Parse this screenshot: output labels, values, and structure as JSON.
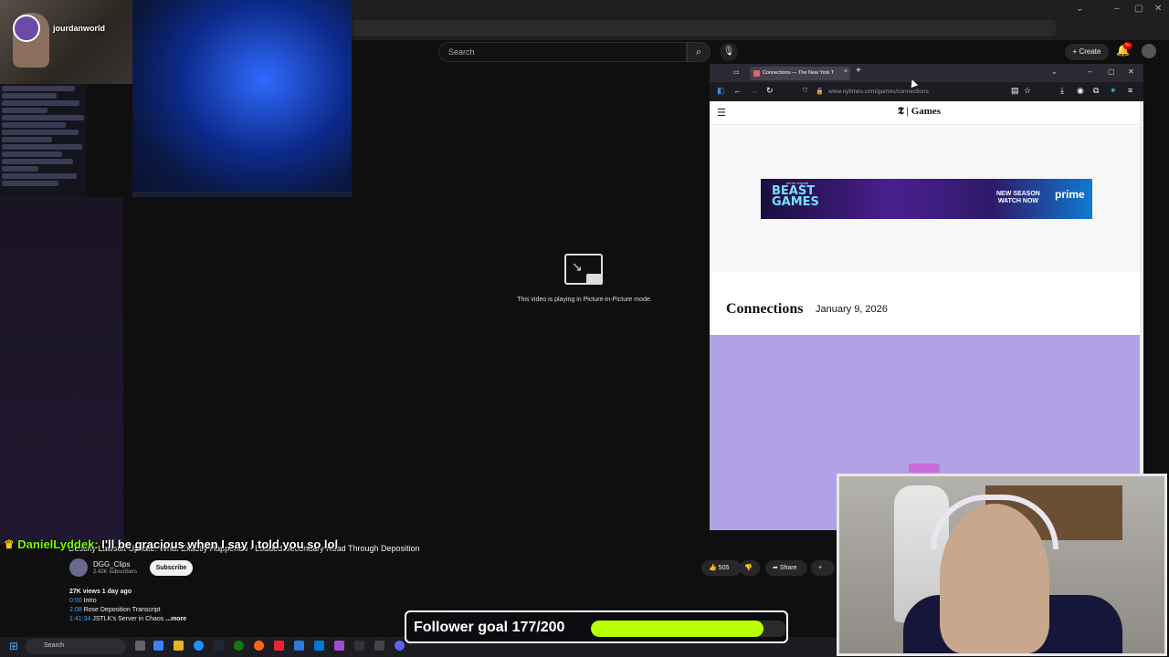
{
  "streamer": {
    "name": "jourdanworld"
  },
  "youtube": {
    "search_placeholder": "Search",
    "create_label": "Create",
    "notification_badge": "9+",
    "pip_message": "This video is playing in Picture-in-Picture mode.",
    "video_title": "Destiny Lawsuit Update: What Exactly Happened - Loaded Secondary Read Through Deposition",
    "channel_name": "DGG_Clips",
    "channel_subs": "2.42K subscribers",
    "subscribe_label": "Subscribe",
    "likes": "505",
    "share_label": "Share",
    "views_line": "27K views  1 day ago",
    "chapters": [
      {
        "time": "0:00",
        "label": "Intro"
      },
      {
        "time": "2:08",
        "label": "Rose Deposition Transcript"
      },
      {
        "time": "1:41:34",
        "label": "JSTLK's Server in Chaos"
      }
    ],
    "more_label": "...more"
  },
  "chat_overlay": {
    "username": "DanielLyddek:",
    "message": "I'll be gracious when I say I told you so lol"
  },
  "follower_goal": {
    "label": "Follower goal 177/200",
    "current": 177,
    "target": 200
  },
  "taskbar": {
    "search_label": "Search"
  },
  "browser": {
    "tab_title": "Connections — The New York T",
    "url": "www.nytimes.com/games/connections",
    "site_logo": "Games",
    "ad": {
      "small_text": "prime original",
      "title_line1": "BEAST",
      "title_line2": "GAMES",
      "cta_line1": "NEW SEASON",
      "cta_line2": "WATCH NOW",
      "brand": "prime"
    },
    "page_title": "Connections",
    "page_date": "January 9, 2026"
  },
  "colors": {
    "goal_fill": "#b8ff00",
    "connections_purple": "#b1a2e5",
    "timestamp_link": "#3ea6ff"
  }
}
